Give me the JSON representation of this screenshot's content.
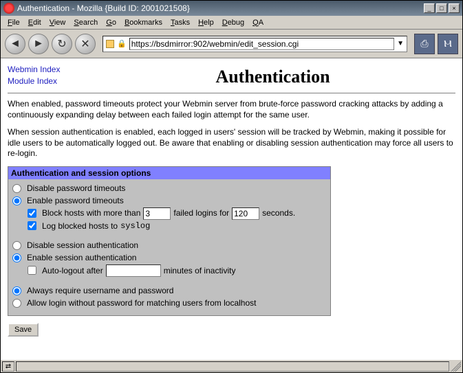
{
  "window": {
    "title": "Authentication - Mozilla {Build ID: 2001021508}"
  },
  "menu": {
    "file": "File",
    "edit": "Edit",
    "view": "View",
    "search": "Search",
    "go": "Go",
    "bookmarks": "Bookmarks",
    "tasks": "Tasks",
    "help": "Help",
    "debug": "Debug",
    "qa": "QA"
  },
  "toolbar": {
    "url": "https://bsdmirror:902/webmin/edit_session.cgi"
  },
  "page": {
    "links": {
      "webmin_index": "Webmin Index",
      "module_index": "Module Index"
    },
    "heading": "Authentication",
    "para1": "When enabled, password timeouts protect your Webmin server from brute-force password cracking attacks by adding a continuously expanding delay between each failed login attempt for the same user.",
    "para2": "When session authentication is enabled, each logged in users' session will be tracked by Webmin, making it possible for idle users to be automatically logged out. Be aware that enabling or disabling session authentication may force all users to re-login.",
    "box": {
      "header": "Authentication and session options",
      "disable_pw_timeouts": "Disable password timeouts",
      "enable_pw_timeouts": "Enable password timeouts",
      "block_prefix": "Block hosts with more than",
      "block_mid": "failed logins for",
      "block_suffix": "seconds.",
      "block_value_tries": "3",
      "block_value_seconds": "120",
      "log_blocked": "Log blocked hosts to ",
      "syslog": "syslog",
      "disable_session": "Disable session authentication",
      "enable_session": "Enable session authentication",
      "auto_logout_prefix": "Auto-logout after",
      "auto_logout_suffix": "minutes of inactivity",
      "auto_logout_value": "",
      "always_require": "Always require username and password",
      "allow_localhost": "Allow login without password for matching users from localhost"
    },
    "save": "Save"
  }
}
